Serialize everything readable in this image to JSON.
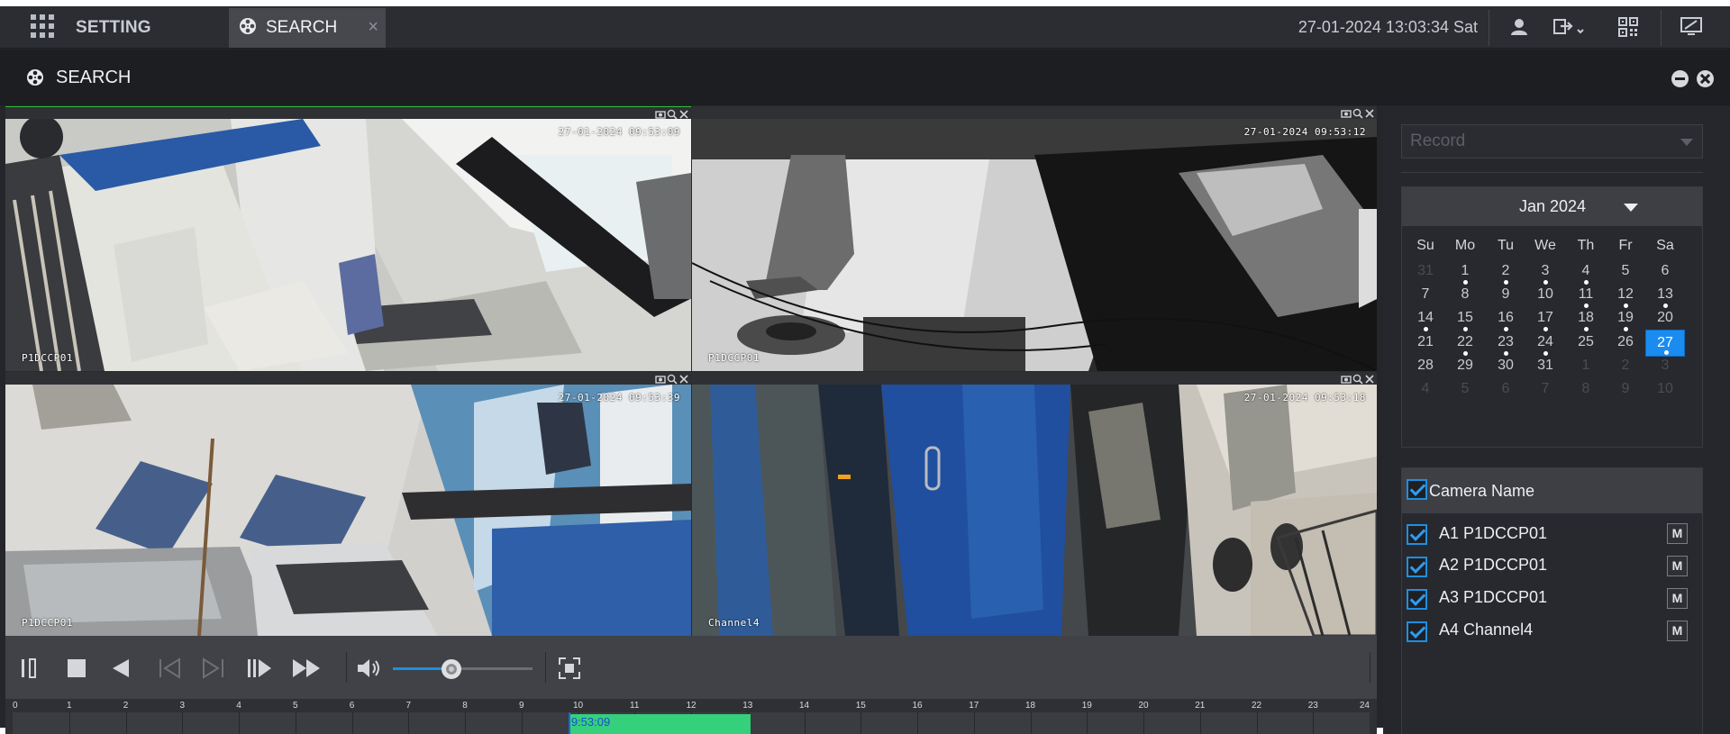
{
  "topbar": {
    "menu_icon": "grid-menu-icon",
    "setting_label": "SETTING",
    "active_tab": {
      "label": "SEARCH",
      "icon": "film-reel-icon",
      "close": "×"
    },
    "datetime": "27-01-2024 13:03:34 Sat",
    "icons": [
      "user-icon",
      "logout-icon",
      "qr-code-icon",
      "monitor-icon"
    ]
  },
  "search_header": {
    "title": "SEARCH",
    "icon": "film-reel-icon"
  },
  "cameras": [
    {
      "osd_time": "27-01-2024 09:53:09",
      "osd_name": "P1DCCP01",
      "selected": true
    },
    {
      "osd_time": "27-01-2024 09:53:12",
      "osd_name": "P1DCCP01",
      "selected": false
    },
    {
      "osd_time": "27-01-2024 09:53:39",
      "osd_name": "P1DCCP01",
      "selected": false
    },
    {
      "osd_time": "27-01-2024 09:53:18",
      "osd_name": "Channel4",
      "selected": false
    }
  ],
  "playback": {
    "buttons": [
      "pause-icon",
      "stop-icon",
      "reverse-play-icon",
      "previous-frame-icon",
      "next-frame-icon",
      "slow-play-icon",
      "fast-forward-icon",
      "volume-icon",
      "fullscreen-icon"
    ],
    "volume_fraction": 0.42
  },
  "timeline": {
    "hour_labels": [
      "0",
      "1",
      "2",
      "3",
      "4",
      "5",
      "6",
      "7",
      "8",
      "9",
      "10",
      "11",
      "12",
      "13",
      "14",
      "15",
      "16",
      "17",
      "18",
      "19",
      "20",
      "21",
      "22",
      "23",
      "24"
    ],
    "cursor_time": "9:53:09",
    "record_start_hour": 9.83,
    "record_end_hour": 13.05,
    "colors": {
      "record": "#35d07c",
      "cursor": "#1f64e0"
    }
  },
  "panel": {
    "record_type": {
      "placeholder": "Record"
    },
    "calendar": {
      "month_label": "Jan 2024",
      "weekdays": [
        "Su",
        "Mo",
        "Tu",
        "We",
        "Th",
        "Fr",
        "Sa"
      ],
      "weeks": [
        [
          {
            "d": "31",
            "o": true
          },
          {
            "d": "1",
            "r": true
          },
          {
            "d": "2",
            "r": true
          },
          {
            "d": "3",
            "r": true
          },
          {
            "d": "4",
            "r": true
          },
          {
            "d": "5"
          },
          {
            "d": "6"
          }
        ],
        [
          {
            "d": "7"
          },
          {
            "d": "8"
          },
          {
            "d": "9"
          },
          {
            "d": "10"
          },
          {
            "d": "11",
            "r": true
          },
          {
            "d": "12",
            "r": true
          },
          {
            "d": "13",
            "r": true
          }
        ],
        [
          {
            "d": "14",
            "r": true
          },
          {
            "d": "15",
            "r": true
          },
          {
            "d": "16",
            "r": true
          },
          {
            "d": "17",
            "r": true
          },
          {
            "d": "18",
            "r": true
          },
          {
            "d": "19",
            "r": true
          },
          {
            "d": "20"
          }
        ],
        [
          {
            "d": "21"
          },
          {
            "d": "22",
            "r": true
          },
          {
            "d": "23",
            "r": true
          },
          {
            "d": "24",
            "r": true
          },
          {
            "d": "25"
          },
          {
            "d": "26"
          },
          {
            "d": "27",
            "r": true,
            "t": true
          }
        ],
        [
          {
            "d": "28"
          },
          {
            "d": "29"
          },
          {
            "d": "30"
          },
          {
            "d": "31"
          },
          {
            "d": "1",
            "o": true
          },
          {
            "d": "2",
            "o": true
          },
          {
            "d": "3",
            "o": true
          }
        ],
        [
          {
            "d": "4",
            "o": true
          },
          {
            "d": "5",
            "o": true
          },
          {
            "d": "6",
            "o": true
          },
          {
            "d": "7",
            "o": true
          },
          {
            "d": "8",
            "o": true
          },
          {
            "d": "9",
            "o": true
          },
          {
            "d": "10",
            "o": true
          }
        ]
      ],
      "selected_day": "27"
    },
    "camera_list": {
      "header_label": "Camera Name",
      "items": [
        {
          "label": "A1 P1DCCP01",
          "checked": true,
          "button": "M"
        },
        {
          "label": "A2 P1DCCP01",
          "checked": true,
          "button": "M"
        },
        {
          "label": "A3 P1DCCP01",
          "checked": true,
          "button": "M"
        },
        {
          "label": "A4 Channel4",
          "checked": true,
          "button": "M"
        }
      ]
    }
  }
}
